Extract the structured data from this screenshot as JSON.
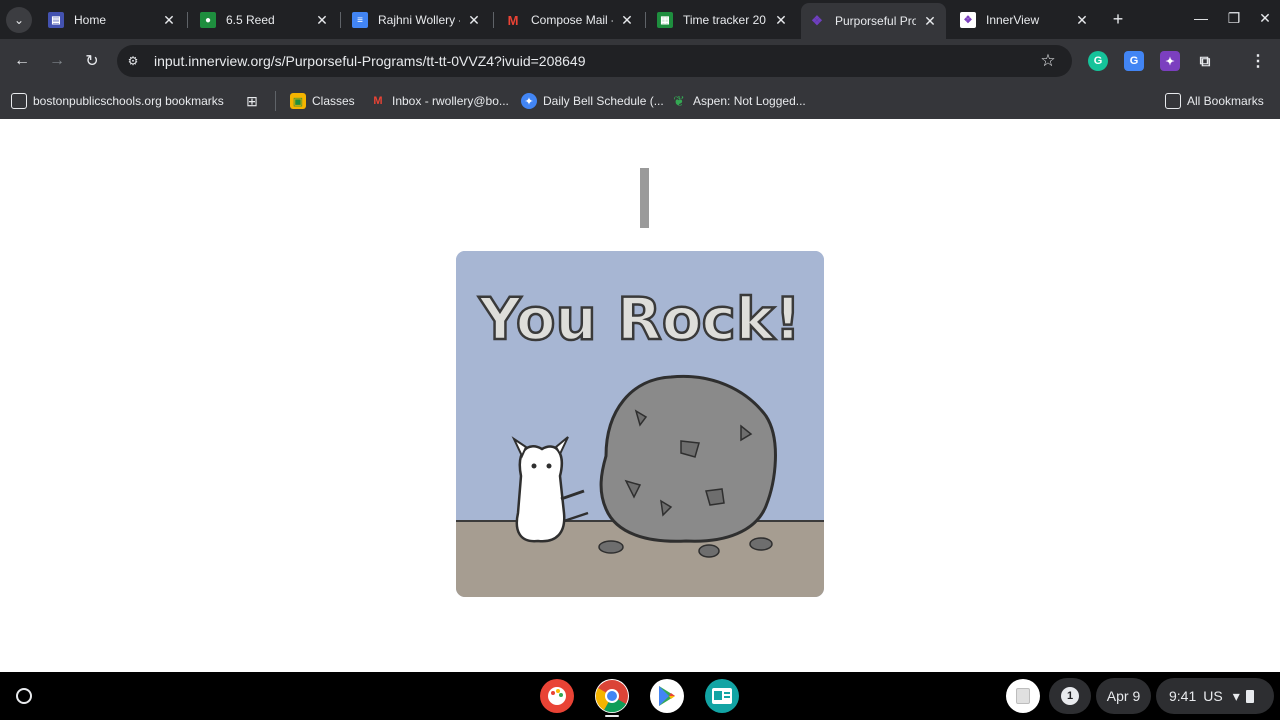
{
  "tabs": [
    {
      "title": "Home",
      "favicon": "classroom-icon",
      "color": "#4352b0"
    },
    {
      "title": "6.5 Reed",
      "favicon": "classroom-icon",
      "color": "#1e8e3e"
    },
    {
      "title": "Rajhni Wollery -",
      "favicon": "docs-icon",
      "color": "#4285f4"
    },
    {
      "title": "Compose Mail -",
      "favicon": "gmail-icon",
      "color": "#ea4335"
    },
    {
      "title": "Time tracker 20",
      "favicon": "sheets-icon",
      "color": "#1e8e3e"
    },
    {
      "title": "Purporseful Pro",
      "favicon": "innerview-icon",
      "color": "#5a2ca0"
    },
    {
      "title": "InnerView",
      "favicon": "innerview-icon",
      "color": "#7b3fbf"
    }
  ],
  "address_bar": {
    "url": "input.innerview.org/s/Purporseful-Programs/tt-tt-0VVZ4?ivuid=208649"
  },
  "bookmarks": {
    "items": [
      {
        "label": "bostonpublicschools.org bookmarks"
      },
      {
        "label": "Classes"
      },
      {
        "label": "Inbox - rwollery@bo..."
      },
      {
        "label": "Daily Bell Schedule (..."
      },
      {
        "label": "Aspen: Not Logged..."
      }
    ],
    "all_bookmarks": "All Bookmarks"
  },
  "card": {
    "headline": "You Rock!"
  },
  "shelf": {
    "notification_count": "1",
    "date": "Apr 9",
    "time": "9:41",
    "locale": "US"
  },
  "colors": {
    "card_sky": "#a7b6d3",
    "card_ground": "#a69d91",
    "rock": "#8a8a8a"
  }
}
